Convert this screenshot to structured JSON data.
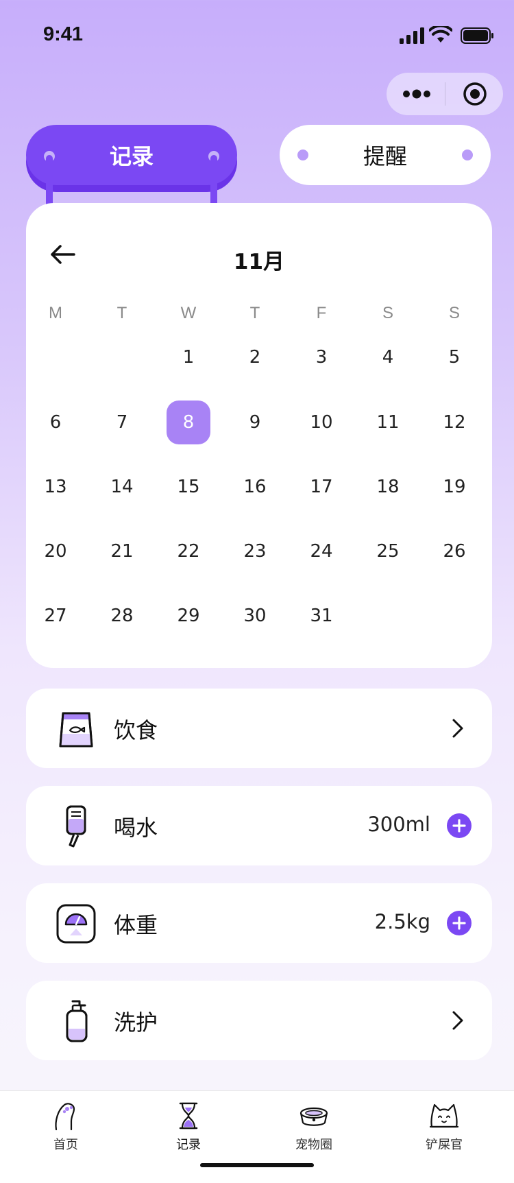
{
  "status_bar": {
    "time": "9:41"
  },
  "segmented": {
    "record_label": "记录",
    "remind_label": "提醒"
  },
  "calendar": {
    "month": "11月",
    "weekdays": [
      "M",
      "T",
      "W",
      "T",
      "F",
      "S",
      "S"
    ],
    "selected_day": "8",
    "weeks": [
      [
        "",
        "",
        "1",
        "2",
        "3",
        "4",
        "5"
      ],
      [
        "6",
        "7",
        "8",
        "9",
        "10",
        "11",
        "12"
      ],
      [
        "13",
        "14",
        "15",
        "16",
        "17",
        "18",
        "19"
      ],
      [
        "20",
        "21",
        "22",
        "23",
        "24",
        "25",
        "26"
      ],
      [
        "27",
        "28",
        "29",
        "30",
        "31",
        "",
        ""
      ]
    ]
  },
  "records": [
    {
      "label": "饮食",
      "icon": "food-bag-icon",
      "value": "",
      "action": "chevron"
    },
    {
      "label": "喝水",
      "icon": "water-bottle-icon",
      "value": "300ml",
      "action": "plus"
    },
    {
      "label": "体重",
      "icon": "scale-icon",
      "value": "2.5kg",
      "action": "plus"
    },
    {
      "label": "洗护",
      "icon": "shampoo-bottle-icon",
      "value": "",
      "action": "chevron"
    }
  ],
  "tabbar": {
    "items": [
      {
        "label": "首页",
        "icon": "paw-icon"
      },
      {
        "label": "记录",
        "icon": "hourglass-icon"
      },
      {
        "label": "宠物圈",
        "icon": "pet-bowl-icon"
      },
      {
        "label": "铲屎官",
        "icon": "cat-face-icon"
      }
    ]
  },
  "colors": {
    "accent": "#7B48F3",
    "selected_day": "#A883F5",
    "dot": "#B99BF8"
  }
}
